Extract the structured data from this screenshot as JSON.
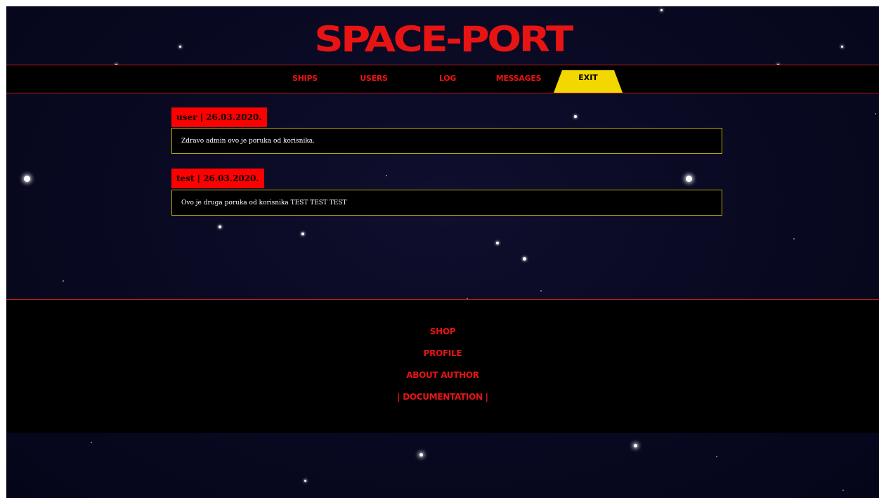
{
  "site": {
    "logo_text": "SPACE-PORT"
  },
  "nav": {
    "items": [
      "SHIPS",
      "USERS",
      "LOG",
      "MESSAGES"
    ],
    "exit_label": "EXIT"
  },
  "messages": [
    {
      "header": "user | 26.03.2020.",
      "body": "Zdravo admin ovo je poruka od korisnika."
    },
    {
      "header": "test | 26.03.2020.",
      "body": "Ovo je druga poruka od korisnika TEST TEST TEST"
    }
  ],
  "footer": {
    "links": [
      "SHOP",
      "PROFILE",
      "ABOUT AUTHOR",
      "| DOCUMENTATION |"
    ]
  },
  "colors": {
    "accent_red": "#e81414",
    "exit_yellow": "#f2d800",
    "message_border": "#b8a800",
    "background": "#080820"
  }
}
